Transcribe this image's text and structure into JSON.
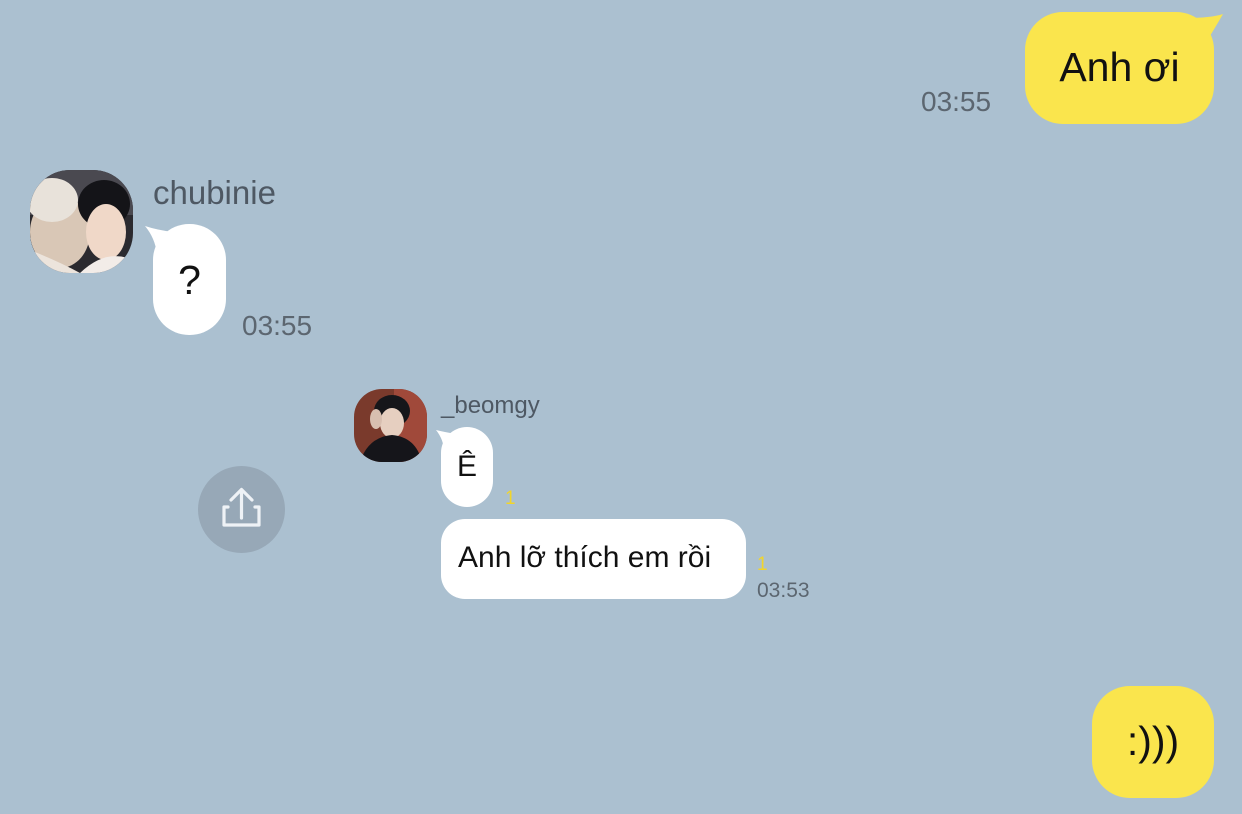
{
  "messages": {
    "m1": {
      "text": "Anh ơi",
      "time": "03:55",
      "side": "mine"
    },
    "m2": {
      "sender": "chubinie",
      "text": "?",
      "time": "03:55",
      "side": "theirs"
    },
    "m3": {
      "sender": "_beomgy",
      "text": "Ê",
      "unread": "1",
      "side": "theirs"
    },
    "m4": {
      "text": "Anh lỡ thích em rồi",
      "unread": "1",
      "time": "03:53",
      "side": "theirs"
    },
    "m5": {
      "text": ":)))",
      "side": "mine"
    }
  },
  "icons": {
    "share": "share-upload-icon",
    "avatar_chubinie": "avatar-photo",
    "avatar_beomgy": "avatar-photo"
  },
  "colors": {
    "background": "#abc0d0",
    "my_bubble": "#fae54d",
    "their_bubble": "#ffffff",
    "unread_count": "#f2d52a",
    "timestamp": "#5c6670",
    "share_button": "#97a8b7"
  }
}
